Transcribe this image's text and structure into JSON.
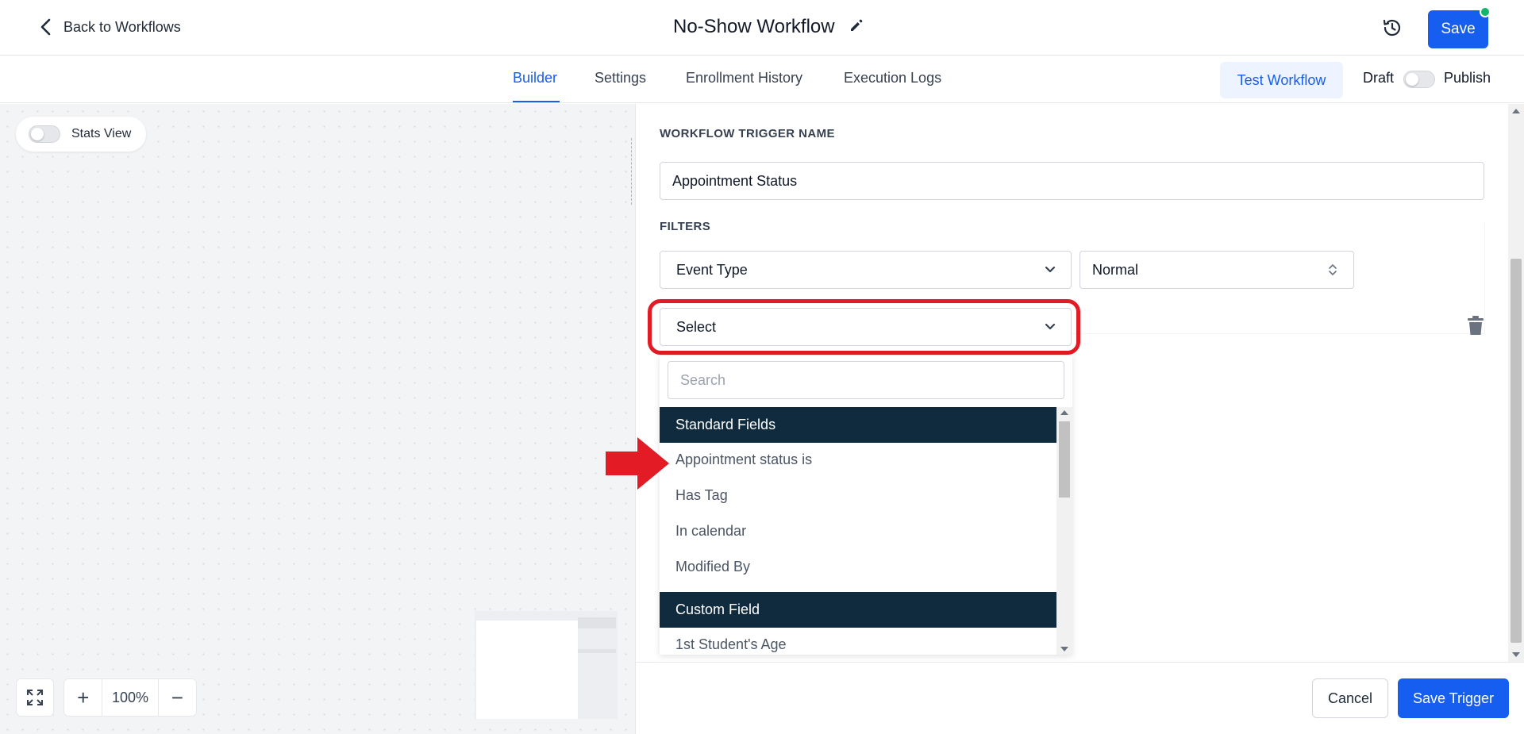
{
  "header": {
    "back_label": "Back to Workflows",
    "title": "No-Show Workflow",
    "save_label": "Save",
    "history_icon": "history-icon",
    "edit_icon": "pencil-icon"
  },
  "tabs": [
    {
      "label": "Builder",
      "active": true
    },
    {
      "label": "Settings",
      "active": false
    },
    {
      "label": "Enrollment History",
      "active": false
    },
    {
      "label": "Execution Logs",
      "active": false
    }
  ],
  "toolbar": {
    "test_label": "Test Workflow",
    "draft_label": "Draft",
    "publish_label": "Publish",
    "published": false
  },
  "canvas": {
    "stats_label": "Stats View",
    "stats_enabled": false,
    "zoom": "100%",
    "zoom_in": "+",
    "zoom_out": "−"
  },
  "trigger": {
    "name_label": "WORKFLOW TRIGGER NAME",
    "name_value": "Appointment Status",
    "filters_label": "FILTERS",
    "filter_field": "Event Type",
    "filter_value": "Normal",
    "new_filter_value": "Select",
    "search_placeholder": "Search",
    "groups": [
      {
        "label": "Standard Fields",
        "items": [
          "Appointment status is",
          "Has Tag",
          "In calendar",
          "Modified By"
        ]
      },
      {
        "label": "Custom Field",
        "items": [
          "1st Student's Age"
        ]
      }
    ]
  },
  "footer": {
    "cancel_label": "Cancel",
    "save_trigger_label": "Save Trigger"
  },
  "colors": {
    "accent": "#155eef",
    "group_header": "#0f2b3d",
    "highlight": "#e21b24",
    "online_dot": "#12b76a"
  }
}
